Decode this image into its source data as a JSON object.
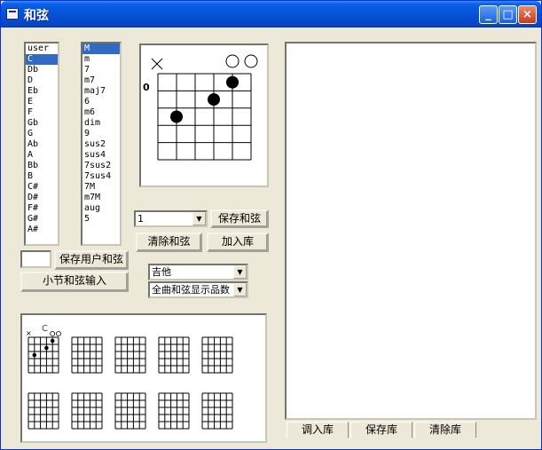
{
  "window": {
    "title": "和弦"
  },
  "root_list": {
    "items": [
      "user",
      "C",
      "Db",
      "D",
      "Eb",
      "E",
      "F",
      "Gb",
      "G",
      "Ab",
      "A",
      "Bb",
      "B",
      "C#",
      "D#",
      "F#",
      "G#",
      "A#"
    ],
    "selected": 1
  },
  "type_list": {
    "items": [
      "M",
      "m",
      "7",
      "m7",
      "maj7",
      "6",
      "m6",
      "dim",
      "9",
      "sus2",
      "sus4",
      "7sus2",
      "7sus4",
      "7M",
      "m7M",
      "aug",
      "5"
    ],
    "selected": 0
  },
  "chord_diagram": {
    "fret_label": "0",
    "string_marks": [
      "x",
      "",
      "",
      "",
      "o",
      "o"
    ],
    "dots": [
      [
        4,
        1
      ],
      [
        3,
        2
      ],
      [
        1,
        3
      ]
    ]
  },
  "fret_select": {
    "value": "1"
  },
  "buttons": {
    "save_chord": "保存和弦",
    "clear_chord": "清除和弦",
    "add_library": "加入库",
    "save_user_chord": "保存用户和弦",
    "measure_input": "小节和弦输入"
  },
  "instrument_select": {
    "value": "吉他"
  },
  "display_select": {
    "value": "全曲和弦显示品数"
  },
  "thumbnails": {
    "first_label": "C"
  },
  "tabs": [
    "调入库",
    "保存库",
    "清除库"
  ],
  "colors": {
    "selection": "#316ac5",
    "titlebar": "#0552d6",
    "face": "#ece9d8"
  }
}
